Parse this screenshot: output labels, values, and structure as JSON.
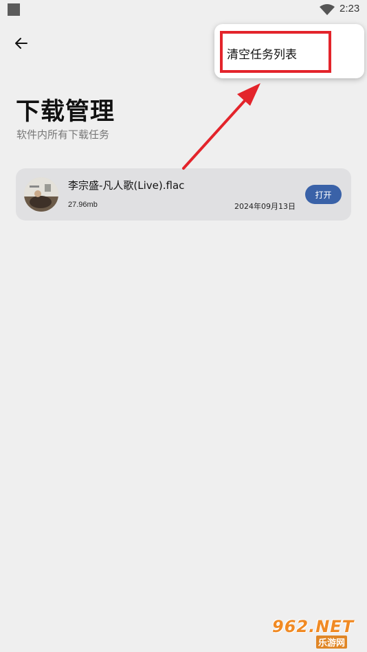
{
  "status_bar": {
    "time": "2:23"
  },
  "header": {
    "title": "下载管理",
    "subtitle": "软件内所有下载任务"
  },
  "tasks": [
    {
      "name": "李宗盛-凡人歌(Live).flac",
      "size": "27.96mb",
      "date": "2024年09月13日",
      "action_label": "打开"
    }
  ],
  "menu": {
    "items": [
      {
        "label": "清空任务列表"
      }
    ]
  },
  "watermark": {
    "logo_text": "962.NET",
    "sub_text": "乐游网"
  },
  "colors": {
    "background": "#efefef",
    "card": "#e0e0e2",
    "open_button": "#3a62a8",
    "annotation": "#e3242b"
  }
}
